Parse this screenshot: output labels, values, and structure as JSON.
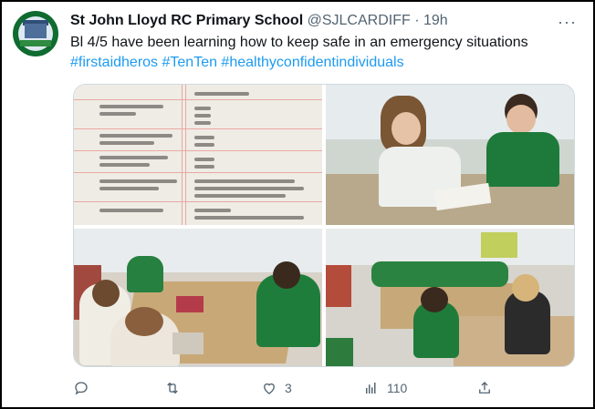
{
  "tweet": {
    "author_name": "St John Lloyd RC Primary School",
    "handle": "@SJLCARDIFF",
    "separator": "·",
    "time": "19h",
    "more": "···",
    "text": "Bl 4/5 have been learning how to keep safe in an emergency situations",
    "hashtags": "#firstaidheros #TenTen #healthyconfidentindividuals"
  },
  "actions": {
    "reply_icon": "reply-icon",
    "retweet_icon": "retweet-icon",
    "like_icon": "heart-icon",
    "like_count": "3",
    "views_icon": "analytics-icon",
    "views_count": "110",
    "share_icon": "share-icon"
  },
  "colors": {
    "link": "#1d9bf0",
    "secondary": "#536471",
    "primary_text": "#0f1419"
  }
}
